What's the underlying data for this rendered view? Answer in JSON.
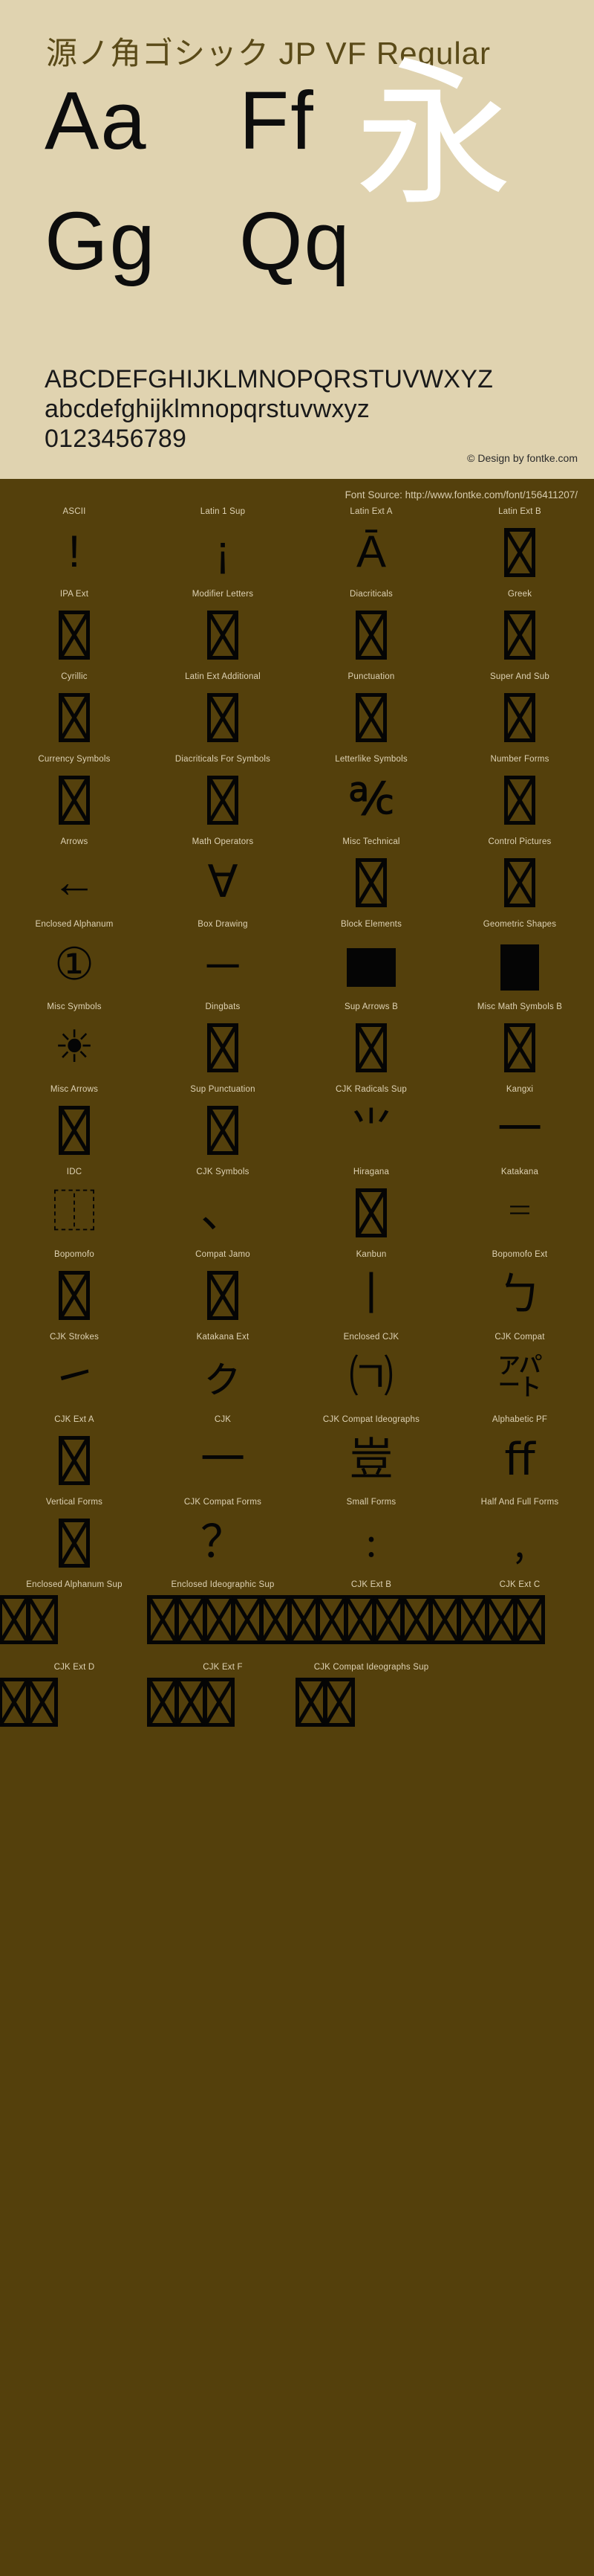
{
  "header": {
    "title": "源ノ角ゴシック JP VF Regular",
    "samples": {
      "row1": [
        "Aa",
        "Ff"
      ],
      "row2": [
        "Gg",
        "Qq"
      ],
      "cjk": "永"
    },
    "alphabet_upper": "ABCDEFGHIJKLMNOPQRSTUVWXYZ",
    "alphabet_lower": "abcdefghijklmnopqrstuvwxyz",
    "digits": "0123456789",
    "credit": "© Design by fontke.com",
    "colors": {
      "header_bg": "#e0d3b0",
      "body_bg": "#54400c",
      "title_text": "#5a4a18",
      "label_text": "#ded2b4",
      "glyph": "#050505",
      "cjk_sample": "#ffffff"
    }
  },
  "body": {
    "font_source": "Font Source: http://www.fontke.com/font/156411207/",
    "rows": [
      [
        {
          "label": "ASCII",
          "glyph": "!",
          "kind": "text"
        },
        {
          "label": "Latin 1 Sup",
          "glyph": "¡",
          "kind": "text"
        },
        {
          "label": "Latin Ext A",
          "glyph": "Ā",
          "kind": "text"
        },
        {
          "label": "Latin Ext B",
          "glyph": "",
          "kind": "tofu"
        }
      ],
      [
        {
          "label": "IPA Ext",
          "glyph": "",
          "kind": "tofu"
        },
        {
          "label": "Modifier Letters",
          "glyph": "",
          "kind": "tofu"
        },
        {
          "label": "Diacriticals",
          "glyph": "",
          "kind": "tofu"
        },
        {
          "label": "Greek",
          "glyph": "",
          "kind": "tofu"
        }
      ],
      [
        {
          "label": "Cyrillic",
          "glyph": "",
          "kind": "tofu"
        },
        {
          "label": "Latin Ext Additional",
          "glyph": "",
          "kind": "tofu"
        },
        {
          "label": "Punctuation",
          "glyph": "",
          "kind": "tofu"
        },
        {
          "label": "Super And Sub",
          "glyph": "",
          "kind": "tofu"
        }
      ],
      [
        {
          "label": "Currency Symbols",
          "glyph": "",
          "kind": "tofu"
        },
        {
          "label": "Diacriticals For Symbols",
          "glyph": "",
          "kind": "tofu"
        },
        {
          "label": "Letterlike Symbols",
          "glyph": "℀",
          "kind": "text"
        },
        {
          "label": "Number Forms",
          "glyph": "",
          "kind": "tofu"
        }
      ],
      [
        {
          "label": "Arrows",
          "glyph": "←",
          "kind": "text"
        },
        {
          "label": "Math Operators",
          "glyph": "∀",
          "kind": "text"
        },
        {
          "label": "Misc Technical",
          "glyph": "",
          "kind": "tofu"
        },
        {
          "label": "Control Pictures",
          "glyph": "",
          "kind": "tofu"
        }
      ],
      [
        {
          "label": "Enclosed Alphanum",
          "glyph": "①",
          "kind": "text"
        },
        {
          "label": "Box Drawing",
          "glyph": "─",
          "kind": "text"
        },
        {
          "label": "Block Elements",
          "glyph": "",
          "kind": "block"
        },
        {
          "label": "Geometric Shapes",
          "glyph": "",
          "kind": "geo"
        }
      ],
      [
        {
          "label": "Misc Symbols",
          "glyph": "☀",
          "kind": "text"
        },
        {
          "label": "Dingbats",
          "glyph": "",
          "kind": "tofu"
        },
        {
          "label": "Sup Arrows B",
          "glyph": "",
          "kind": "tofu"
        },
        {
          "label": "Misc Math Symbols B",
          "glyph": "",
          "kind": "tofu"
        }
      ],
      [
        {
          "label": "Misc Arrows",
          "glyph": "",
          "kind": "tofu"
        },
        {
          "label": "Sup Punctuation",
          "glyph": "",
          "kind": "tofu"
        },
        {
          "label": "CJK Radicals Sup",
          "glyph": "⺌",
          "kind": "text"
        },
        {
          "label": "Kangxi",
          "glyph": "⼀",
          "kind": "text"
        }
      ],
      [
        {
          "label": "IDC",
          "glyph": "⿰",
          "kind": "text"
        },
        {
          "label": "CJK Symbols",
          "glyph": "、",
          "kind": "text"
        },
        {
          "label": "Hiragana",
          "glyph": "",
          "kind": "tofu"
        },
        {
          "label": "Katakana",
          "glyph": "゠",
          "kind": "text"
        }
      ],
      [
        {
          "label": "Bopomofo",
          "glyph": "",
          "kind": "tofu"
        },
        {
          "label": "Compat Jamo",
          "glyph": "",
          "kind": "tofu"
        },
        {
          "label": "Kanbun",
          "glyph": "丨",
          "kind": "text"
        },
        {
          "label": "Bopomofo Ext",
          "glyph": "ㄅ",
          "kind": "text"
        }
      ],
      [
        {
          "label": "CJK Strokes",
          "glyph": "㇀",
          "kind": "text"
        },
        {
          "label": "Katakana Ext",
          "glyph": "ㇰ",
          "kind": "text"
        },
        {
          "label": "Enclosed CJK",
          "glyph": "㈀",
          "kind": "text"
        },
        {
          "label": "CJK Compat",
          "glyph": "㌀",
          "kind": "text"
        }
      ],
      [
        {
          "label": "CJK Ext A",
          "glyph": "",
          "kind": "tofu"
        },
        {
          "label": "CJK",
          "glyph": "一",
          "kind": "text"
        },
        {
          "label": "CJK Compat Ideographs",
          "glyph": "豈",
          "kind": "text"
        },
        {
          "label": "Alphabetic PF",
          "glyph": "ﬀ",
          "kind": "text"
        }
      ],
      [
        {
          "label": "Vertical Forms",
          "glyph": "",
          "kind": "tofu"
        },
        {
          "label": "CJK Compat Forms",
          "glyph": "？",
          "kind": "text"
        },
        {
          "label": "Small Forms",
          "glyph": "﹕",
          "kind": "text"
        },
        {
          "label": "Half And Full Forms",
          "glyph": "﹐",
          "kind": "text"
        }
      ],
      [
        {
          "label": "Enclosed Alphanum Sup",
          "glyph": "",
          "kind": "strip",
          "count": 2
        },
        {
          "label": "Enclosed Ideographic Sup",
          "glyph": "",
          "kind": "strip",
          "count": 14
        },
        {
          "label": "CJK Ext B",
          "glyph": "",
          "kind": "striphidden"
        },
        {
          "label": "CJK Ext C",
          "glyph": "",
          "kind": "striphidden"
        }
      ],
      [
        {
          "label": "CJK Ext D",
          "glyph": "",
          "kind": "strip",
          "count": 2
        },
        {
          "label": "CJK Ext F",
          "glyph": "",
          "kind": "strip",
          "count": 3
        },
        {
          "label": "CJK Compat Ideographs Sup",
          "glyph": "",
          "kind": "strip",
          "count": 2
        },
        {
          "label": "",
          "glyph": "",
          "kind": "empty"
        }
      ]
    ]
  }
}
